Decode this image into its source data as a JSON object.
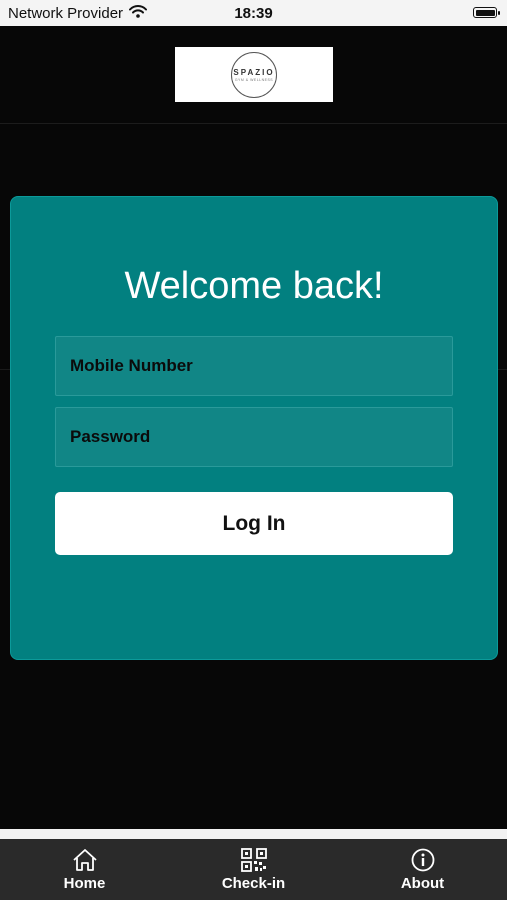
{
  "status_bar": {
    "carrier": "Network Provider",
    "time": "18:39"
  },
  "header": {
    "logo_text": "SPAZIO",
    "logo_subtext": "GYM & WELLNESS"
  },
  "login": {
    "title": "Welcome back!",
    "mobile_placeholder": "Mobile Number",
    "password_placeholder": "Password",
    "login_button": "Log In"
  },
  "tabs": [
    {
      "label": "Home",
      "icon": "home-icon"
    },
    {
      "label": "Check-in",
      "icon": "qr-code-icon"
    },
    {
      "label": "About",
      "icon": "info-icon"
    }
  ],
  "colors": {
    "background": "#070707",
    "card": "#028080",
    "tab_bar": "#2a2a2a"
  }
}
